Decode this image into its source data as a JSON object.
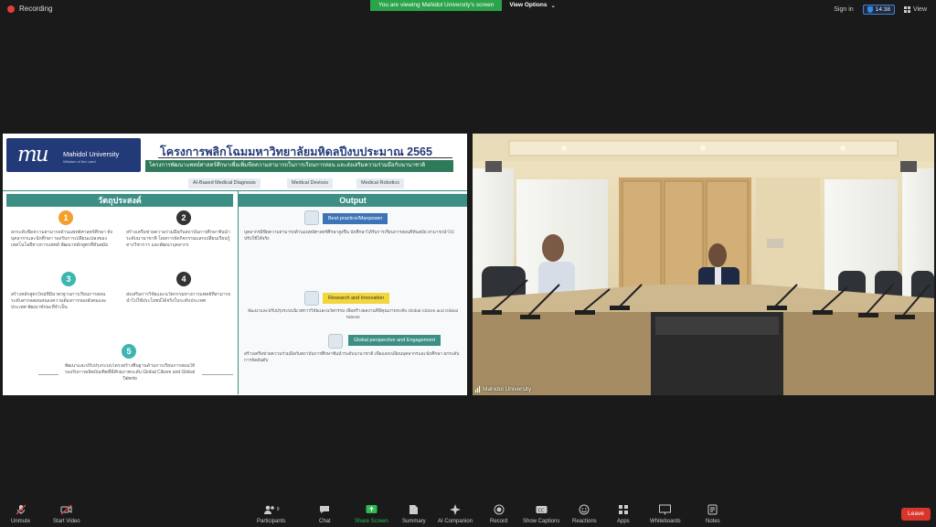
{
  "top": {
    "recording_label": "Recording",
    "share_note": "You are viewing Mahidol University's screen",
    "view_options_label": "View Options",
    "sign_in_label": "Sign in",
    "meeting_time": "14:38",
    "view_label": "View"
  },
  "slide": {
    "logo_mark": "mu",
    "logo_name": "Mahidol University",
    "logo_sub": "Wisdom of the Land",
    "title": "โครงการพลิกโฉมมหาวิทยาลัยมหิดลปีงบประมาณ 2565",
    "subtitle": "โครงการพัฒนาแพทย์ศาสตร์ศึกษาเพื่อเพิ่มขีดความสามารถในการเรียนการสอน และส่งเสริมความร่วมมือกับนานาชาติ",
    "tags": [
      "AI-Based Medical Diagnosis",
      "Medical Devices",
      "Medical Robotics"
    ],
    "objectives_heading": "วัตถุประสงค์",
    "objectives": [
      {
        "num": "1",
        "text": "ยกระดับขีดความสามารถด้านแพทย์ศาสตร์ศึกษา ทั้งบุคลากรและนักศึกษา รองรับการเปลี่ยนแปลงของเทคโนโลยีทางการแพทย์ พัฒนาหลักสูตรที่ทันสมัย"
      },
      {
        "num": "2",
        "text": "สร้างเครือข่ายความร่วมมือกับสถาบันการศึกษาชั้นนำระดับนานาชาติ โดยการจัดกิจกรรมแลกเปลี่ยนเรียนรู้ทางวิชาการ และพัฒนาบุคลากร"
      },
      {
        "num": "3",
        "text": "สร้างหลักสูตรใหม่ที่มีมาตรฐานการเรียนการสอนระดับสากลตอบสนองความต้องการของสังคมและประเทศ พัฒนาทักษะที่จำเป็น"
      },
      {
        "num": "4",
        "text": "ส่งเสริมการวิจัยและนวัตกรรมทางการแพทย์ที่สามารถนำไปใช้ประโยชน์ได้จริงในระดับประเทศ"
      },
      {
        "num": "5",
        "text": "พัฒนาและปรับปรุงระบบโครงสร้างพื้นฐานด้านการเรียนการสอนให้รองรับการผลิตบัณฑิตที่มีศักยภาพระดับ Global Citizen and Global Talents"
      }
    ],
    "output_heading": "Output",
    "outputs": [
      {
        "label": "Best-practice/Manpower",
        "text": "บุคลากรมีขีดความสามารถด้านแพทย์ศาสตร์ศึกษาสูงขึ้น นักศึกษาได้รับการเรียนการสอนที่ทันสมัย สามารถนำไปปรับใช้ได้จริง"
      },
      {
        "label": "Research and Innovation",
        "text": "พัฒนาและปรับปรุงระบบนิเวศการวิจัยและนวัตกรรม เพื่อสร้างผลงานที่มีคุณภาพระดับ Global Citizen and Global Talents"
      },
      {
        "label": "Global perspective and Engagement",
        "text": "สร้างเครือข่ายความร่วมมือกับสถาบันการศึกษาชั้นนำระดับนานาชาติ เพื่อแลกเปลี่ยนบุคลากรและนักศึกษา ยกระดับการจัดอันดับ"
      }
    ]
  },
  "video": {
    "participant_name": "Mahidol University"
  },
  "toolbar": {
    "items": [
      {
        "label": "Unmute",
        "icon": "microphone-muted-icon"
      },
      {
        "label": "Start Video",
        "icon": "video-off-icon"
      },
      {
        "label": "Participants",
        "count": "9",
        "icon": "participants-icon"
      },
      {
        "label": "Chat",
        "icon": "chat-icon"
      },
      {
        "label": "Share Screen",
        "icon": "share-screen-icon"
      },
      {
        "label": "Summary",
        "icon": "summary-icon"
      },
      {
        "label": "AI Companion",
        "icon": "ai-companion-icon"
      },
      {
        "label": "Record",
        "icon": "record-icon"
      },
      {
        "label": "Show Captions",
        "icon": "captions-icon"
      },
      {
        "label": "Reactions",
        "icon": "reactions-icon"
      },
      {
        "label": "Apps",
        "icon": "apps-icon"
      },
      {
        "label": "Whiteboards",
        "icon": "whiteboard-icon"
      },
      {
        "label": "Notes",
        "icon": "notes-icon"
      }
    ],
    "leave_label": "Leave"
  },
  "colors": {
    "share_green": "#2aa34a",
    "leave_red": "#d8362c",
    "mu_blue": "#233a78",
    "slide_teal": "#3d8f85"
  }
}
